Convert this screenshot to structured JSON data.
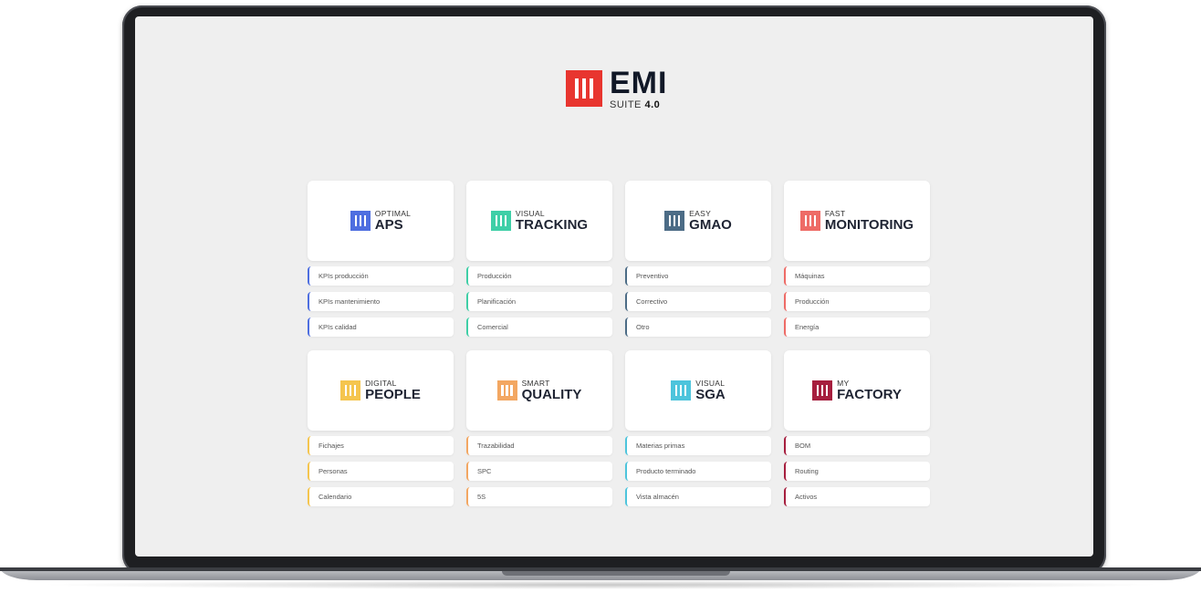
{
  "brand": {
    "name": "EMI",
    "sub_prefix": "SUITE",
    "sub_version": "4.0",
    "color": "#e8352f"
  },
  "modules": [
    {
      "sub": "OPTIMAL",
      "name": "APS",
      "color": "#4e6ee0",
      "items": [
        "KPIs producción",
        "KPIs mantenimiento",
        "KPIs calidad"
      ]
    },
    {
      "sub": "VISUAL",
      "name": "TRACKING",
      "color": "#3fcfa7",
      "items": [
        "Producción",
        "Planificación",
        "Comercial"
      ]
    },
    {
      "sub": "EASY",
      "name": "GMAO",
      "color": "#4c6c86",
      "items": [
        "Preventivo",
        "Correctivo",
        "Otro"
      ]
    },
    {
      "sub": "FAST",
      "name": "MONITORING",
      "color": "#ee6b66",
      "items": [
        "Máquinas",
        "Producción",
        "Energía"
      ]
    },
    {
      "sub": "DIGITAL",
      "name": "PEOPLE",
      "color": "#f5c54e",
      "items": [
        "Fichajes",
        "Personas",
        "Calendario"
      ]
    },
    {
      "sub": "SMART",
      "name": "QUALITY",
      "color": "#f3a762",
      "items": [
        "Trazabilidad",
        "SPC",
        "5S"
      ]
    },
    {
      "sub": "VISUAL",
      "name": "SGA",
      "color": "#4dc4dc",
      "items": [
        "Materias primas",
        "Producto terminado",
        "Vista almacén"
      ]
    },
    {
      "sub": "MY",
      "name": "FACTORY",
      "color": "#a61e3e",
      "items": [
        "BOM",
        "Routing",
        "Activos"
      ]
    }
  ]
}
